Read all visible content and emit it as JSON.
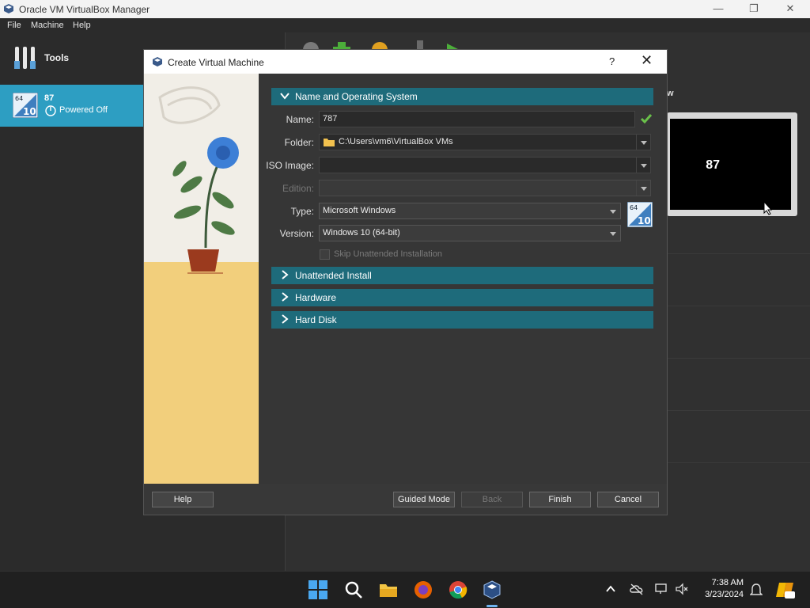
{
  "window": {
    "title": "Oracle VM VirtualBox Manager",
    "minimize": "—",
    "maximize": "❐",
    "close": "✕"
  },
  "menu": {
    "file": "File",
    "machine": "Machine",
    "help": "Help"
  },
  "sidebar": {
    "tools_label": "Tools",
    "vm": {
      "name": "87",
      "state": "Powered Off",
      "os_badge_top": "64",
      "os_badge_num": "10"
    }
  },
  "preview": {
    "label": "w",
    "vm_name": "87"
  },
  "dialog": {
    "title": "Create Virtual Machine",
    "help_q": "?",
    "close": "✕",
    "sections": {
      "name_os": "Name and Operating System",
      "unattended": "Unattended Install",
      "hardware": "Hardware",
      "hard_disk": "Hard Disk"
    },
    "fields": {
      "name_label": "Name:",
      "name_value": "787",
      "folder_label": "Folder:",
      "folder_value": "C:\\Users\\vm6\\VirtualBox VMs",
      "iso_label": "ISO Image:",
      "iso_value": "",
      "edition_label": "Edition:",
      "edition_value": "",
      "type_label": "Type:",
      "type_value": "Microsoft Windows",
      "version_label": "Version:",
      "version_value": "Windows 10 (64-bit)",
      "skip_label": "Skip Unattended Installation"
    },
    "buttons": {
      "help": "Help",
      "guided": "Guided Mode",
      "back": "Back",
      "finish": "Finish",
      "cancel": "Cancel"
    }
  },
  "taskbar": {
    "time": "7:38 AM",
    "date": "3/23/2024"
  },
  "colors": {
    "accent": "#1e6b7b",
    "selection": "#2d9ec2"
  }
}
